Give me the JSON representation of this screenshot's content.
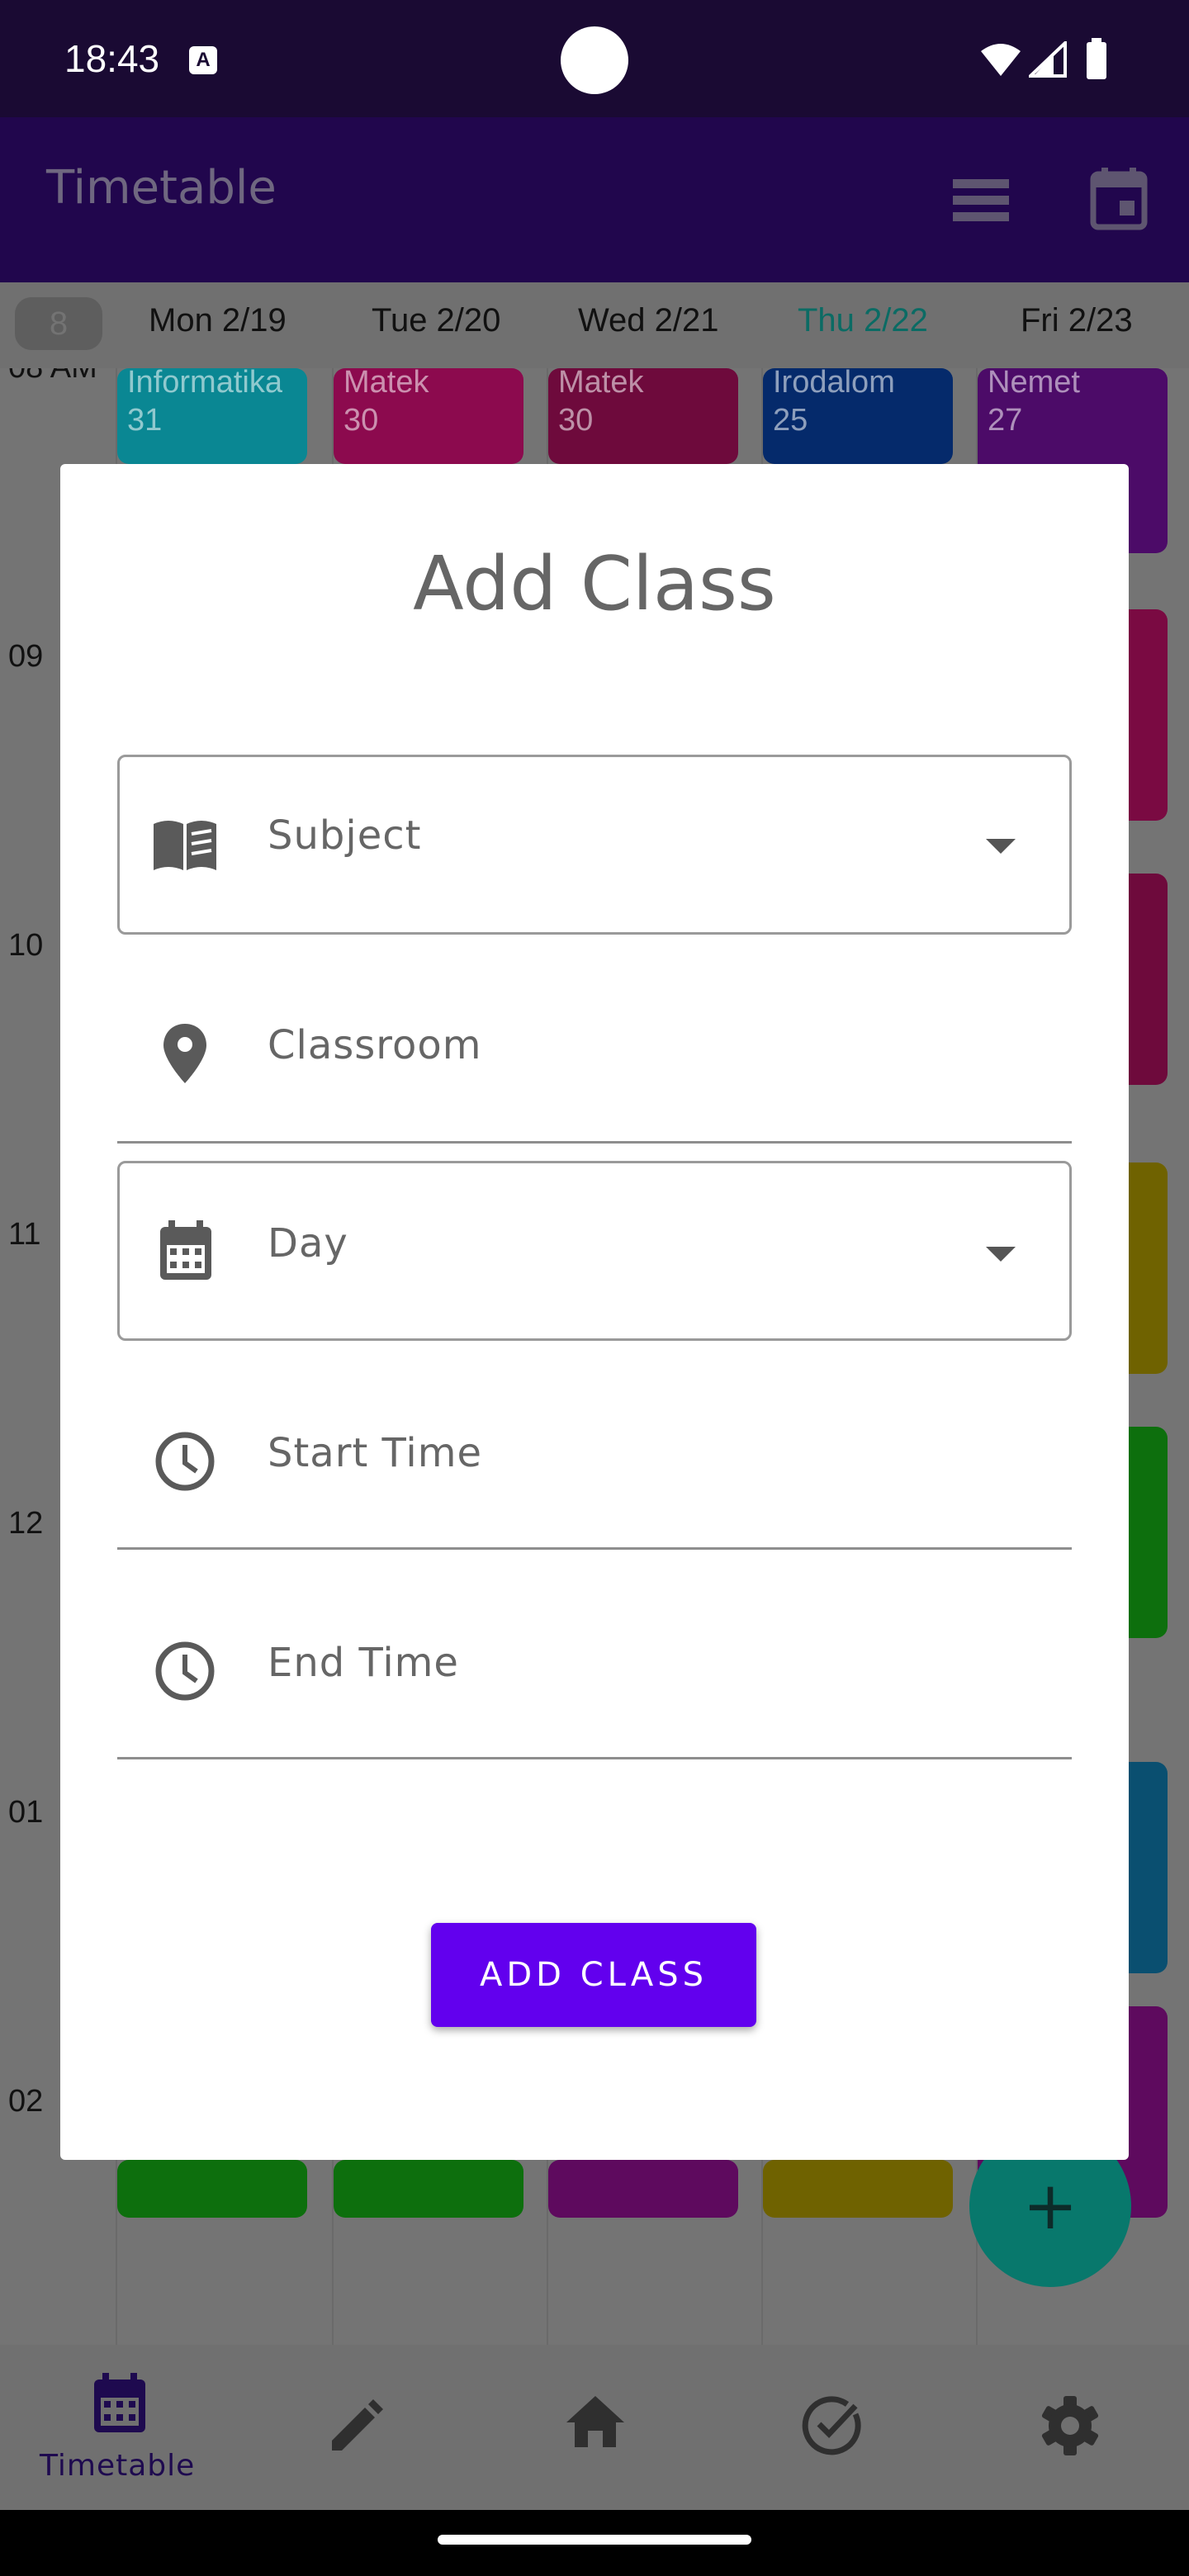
{
  "status_bar": {
    "time": "18:43",
    "a11y_label": "A"
  },
  "app_bar": {
    "title": "Timetable"
  },
  "week": {
    "badge": "8"
  },
  "days": [
    {
      "label": "Mon 2/19",
      "today": false
    },
    {
      "label": "Tue 2/20",
      "today": false
    },
    {
      "label": "Wed 2/21",
      "today": false
    },
    {
      "label": "Thu 2/22",
      "today": true
    },
    {
      "label": "Fri 2/23",
      "today": false
    }
  ],
  "hours": [
    "08 AM",
    "09",
    "10",
    "11",
    "12",
    "01",
    "02"
  ],
  "classes": [
    {
      "subject": "Informatika",
      "room": "31",
      "color": "#0a8793"
    },
    {
      "subject": "Matek",
      "room": "30",
      "color": "#8c0a4e"
    },
    {
      "subject": "Matek",
      "room": "30",
      "color": "#6e0a3c"
    },
    {
      "subject": "Irodalom",
      "room": "25",
      "color": "#052a6b"
    },
    {
      "subject": "Nemet",
      "room": "27",
      "color": "#4c0b68"
    }
  ],
  "dialog": {
    "title": "Add Class",
    "subject_label": "Subject",
    "classroom_label": "Classroom",
    "day_label": "Day",
    "start_time_label": "Start Time",
    "end_time_label": "End Time",
    "submit_label": "ADD CLASS"
  },
  "bottom_nav": {
    "active_label": "Timetable"
  },
  "colors": {
    "primary": "#6200ee",
    "fab": "#08786c",
    "today": "#0b6b64"
  }
}
